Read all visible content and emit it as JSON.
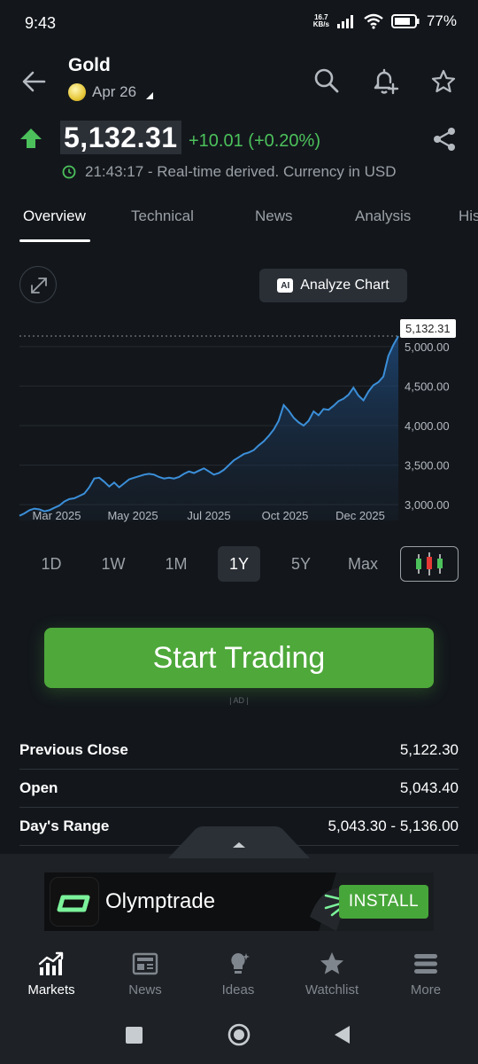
{
  "status_bar": {
    "time": "9:43",
    "net_speed_value": "16.7",
    "net_speed_unit": "KB/s",
    "battery": "77%"
  },
  "header": {
    "asset_name": "Gold",
    "date": "Apr 26"
  },
  "price": {
    "value": "5,132.31",
    "change": "+10.01 (+0.20%)",
    "time_note": "21:43:17 - Real-time derived. Currency in USD"
  },
  "tabs": [
    {
      "label": "Overview",
      "active": true
    },
    {
      "label": "Technical",
      "active": false
    },
    {
      "label": "News",
      "active": false
    },
    {
      "label": "Analysis",
      "active": false
    },
    {
      "label": "His",
      "active": false
    }
  ],
  "chart": {
    "analyze_label": "Analyze Chart",
    "ai_badge": "AI",
    "price_tag": "5,132.31"
  },
  "chart_data": {
    "type": "area",
    "x_tick_labels": [
      "Mar 2025",
      "May 2025",
      "Jul 2025",
      "Oct 2025",
      "Dec 2025"
    ],
    "y_tick_labels": [
      "5,000.00",
      "4,500.00",
      "4,000.00",
      "3,500.00",
      "3,000.00"
    ],
    "y_ticks": [
      5000,
      4500,
      4000,
      3500,
      3000
    ],
    "ylim": [
      2800,
      5200
    ],
    "current_value": 5132.31,
    "series": [
      {
        "values": [
          2860,
          2890,
          2930,
          2950,
          2940,
          2915,
          2930,
          2960,
          2990,
          3040,
          3070,
          3080,
          3110,
          3140,
          3220,
          3330,
          3340,
          3290,
          3230,
          3280,
          3220,
          3270,
          3320,
          3340,
          3360,
          3380,
          3390,
          3380,
          3350,
          3330,
          3340,
          3330,
          3350,
          3390,
          3420,
          3400,
          3430,
          3460,
          3420,
          3380,
          3400,
          3440,
          3500,
          3560,
          3600,
          3640,
          3660,
          3690,
          3750,
          3800,
          3870,
          3950,
          4060,
          4260,
          4190,
          4100,
          4040,
          4000,
          4060,
          4180,
          4130,
          4210,
          4200,
          4250,
          4310,
          4340,
          4390,
          4480,
          4380,
          4320,
          4430,
          4510,
          4550,
          4620,
          4880,
          5020,
          5132
        ]
      }
    ]
  },
  "ranges": [
    {
      "label": "1D",
      "active": false
    },
    {
      "label": "1W",
      "active": false
    },
    {
      "label": "1M",
      "active": false
    },
    {
      "label": "1Y",
      "active": true
    },
    {
      "label": "5Y",
      "active": false
    },
    {
      "label": "Max",
      "active": false
    }
  ],
  "cta": {
    "label": "Start Trading",
    "ad_marker": "| AD |"
  },
  "stats": [
    {
      "label": "Previous Close",
      "value": "5,122.30"
    },
    {
      "label": "Open",
      "value": "5,043.40"
    },
    {
      "label": "Day's Range",
      "value": "5,043.30 - 5,136.00"
    }
  ],
  "ad": {
    "brand": "Olymptrade",
    "install_label": "INSTALL"
  },
  "bottom_nav": [
    {
      "label": "Markets",
      "active": true
    },
    {
      "label": "News",
      "active": false
    },
    {
      "label": "Ideas",
      "active": false
    },
    {
      "label": "Watchlist",
      "active": false
    },
    {
      "label": "More",
      "active": false
    }
  ],
  "colors": {
    "accent_green": "#4cc15b",
    "cta_green": "#4ea83a",
    "chart_line": "#3b8fd9",
    "background": "#13171c"
  }
}
